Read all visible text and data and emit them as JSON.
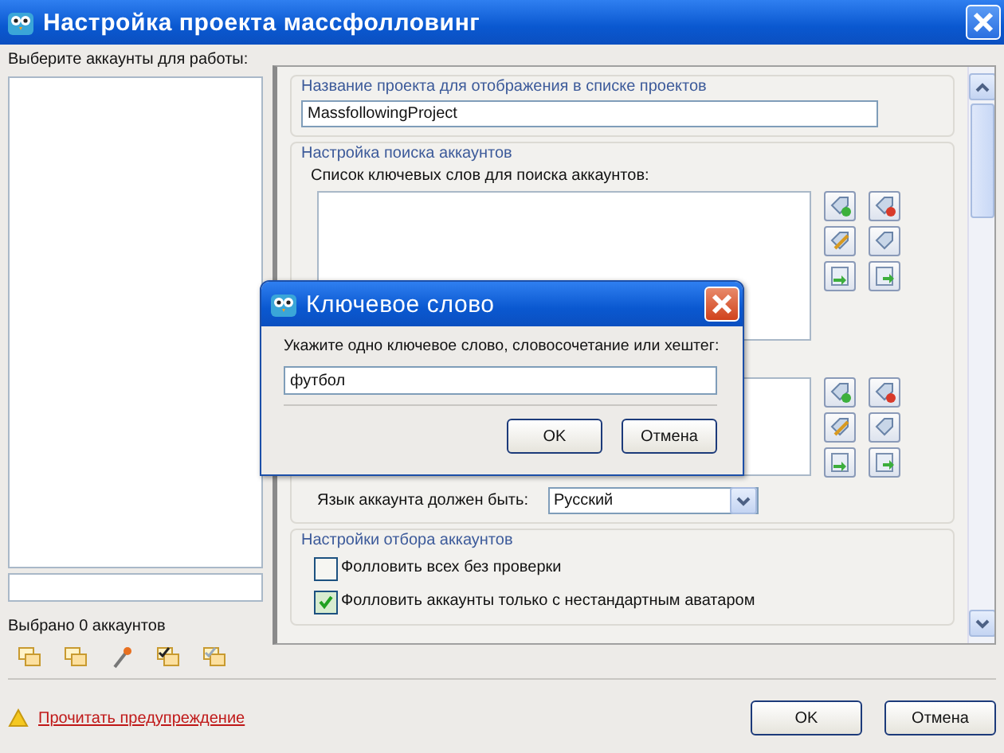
{
  "window": {
    "title": "Настройка проекта массфолловинг"
  },
  "accounts": {
    "label": "Выберите аккаунты для работы:",
    "selected_count": "Выбрано 0 аккаунтов"
  },
  "project_name": {
    "legend": "Название проекта для отображения в списке проектов",
    "value": "MassfollowingProject"
  },
  "search": {
    "legend": "Настройка поиска аккаунтов",
    "keywords_label": "Список ключевых слов для поиска аккаунтов:",
    "language_label": "Язык аккаунта должен быть:",
    "language_value": "Русский"
  },
  "filter": {
    "legend": "Настройки отбора аккаунтов",
    "options": [
      {
        "label": "Фолловить всех без проверки",
        "checked": false
      },
      {
        "label": "Фолловить аккаунты только с нестандартным аватаром",
        "checked": true
      }
    ]
  },
  "warning_link": "Прочитать предупреждение",
  "buttons": [
    "OK",
    "Отмена"
  ],
  "dialog": {
    "title": "Ключевое слово",
    "prompt": "Укажите одно ключевое слово, словосочетание или хештег:",
    "value": "футбол",
    "buttons": [
      "OK",
      "Отмена"
    ]
  }
}
